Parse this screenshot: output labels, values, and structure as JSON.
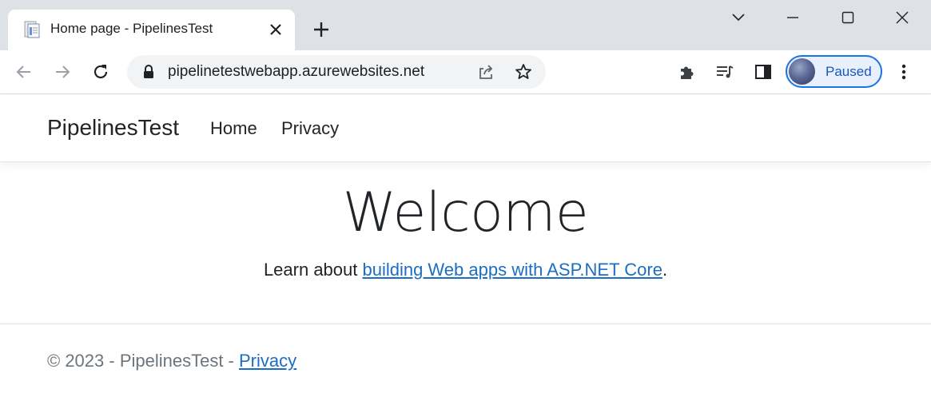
{
  "browser": {
    "tab": {
      "title": "Home page - PipelinesTest",
      "favicon": "document-favicon-icon"
    },
    "address_bar": {
      "url": "pipelinetestwebapp.azurewebsites.net"
    },
    "profile": {
      "status": "Paused"
    },
    "colors": {
      "tabstrip": "#dee1e6",
      "accent": "#1a73e8",
      "omnibox": "#f1f3f4"
    }
  },
  "site": {
    "brand": "PipelinesTest",
    "nav": [
      {
        "label": "Home"
      },
      {
        "label": "Privacy"
      }
    ]
  },
  "main": {
    "heading": "Welcome",
    "learn_prefix": "Learn about ",
    "learn_link": "building Web apps with ASP.NET Core",
    "learn_suffix": "."
  },
  "footer": {
    "text": "© 2023 - PipelinesTest - ",
    "privacy_link": "Privacy"
  },
  "colors": {
    "link": "#1b6ec2",
    "footer_text": "#6c757d"
  }
}
